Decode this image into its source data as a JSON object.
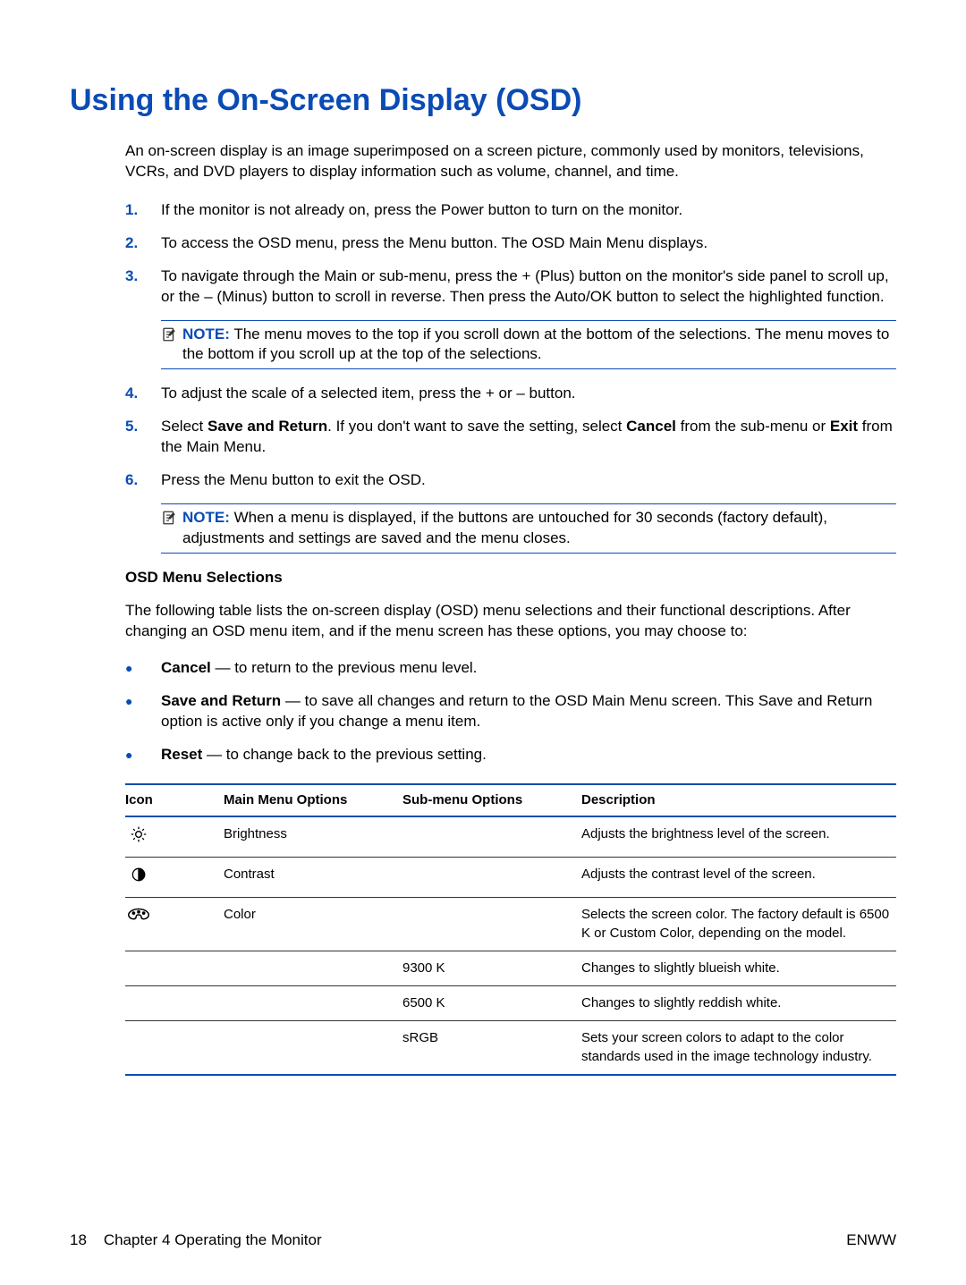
{
  "heading": "Using the On-Screen Display (OSD)",
  "intro": "An on-screen display is an image superimposed on a screen picture, commonly used by monitors, televisions, VCRs, and DVD players to display information such as volume, channel, and time.",
  "steps": {
    "s1": "If the monitor is not already on, press the Power button to turn on the monitor.",
    "s2": "To access the OSD menu, press the Menu button. The OSD Main Menu displays.",
    "s3": "To navigate through the Main or sub-menu, press the + (Plus) button on the monitor's side panel to scroll up, or the – (Minus) button to scroll in reverse. Then press the Auto/OK button to select the highlighted function.",
    "s4": "To adjust the scale of a selected item, press the + or – button.",
    "s5_pre": "Select ",
    "s5_save": "Save and Return",
    "s5_mid": ". If you don't want to save the setting, select ",
    "s5_cancel": "Cancel",
    "s5_mid2": " from the sub-menu or ",
    "s5_exit": "Exit",
    "s5_end": " from the Main Menu.",
    "s6": "Press the Menu button to exit the OSD."
  },
  "notes": {
    "label": "NOTE:",
    "n1": "The menu moves to the top if you scroll down at the bottom of the selections. The menu moves to the bottom if you scroll up at the top of the selections.",
    "n2": "When a menu is displayed, if the buttons are untouched for 30 seconds (factory default), adjustments and settings are saved and the menu closes."
  },
  "subhead": "OSD Menu Selections",
  "para2": "The following table lists the on-screen display (OSD) menu selections and their functional descriptions. After changing an OSD menu item, and if the menu screen has these options, you may choose to:",
  "bullets": {
    "b1_bold": "Cancel",
    "b1_rest": " — to return to the previous menu level.",
    "b2_bold": "Save and Return",
    "b2_rest": " — to save all changes and return to the OSD Main Menu screen. This Save and Return option is active only if you change a menu item.",
    "b3_bold": "Reset",
    "b3_rest": " — to change back to the previous setting."
  },
  "table": {
    "h_icon": "Icon",
    "h_main": "Main Menu Options",
    "h_sub": "Sub-menu Options",
    "h_desc": "Description",
    "rows": [
      {
        "icon": "brightness",
        "main": "Brightness",
        "sub": "",
        "desc": "Adjusts the brightness level of the screen."
      },
      {
        "icon": "contrast",
        "main": "Contrast",
        "sub": "",
        "desc": "Adjusts the contrast level of the screen."
      },
      {
        "icon": "color",
        "main": "Color",
        "sub": "",
        "desc": "Selects the screen color. The factory default is 6500 K or Custom Color, depending on the model."
      },
      {
        "icon": "",
        "main": "",
        "sub": "9300 K",
        "desc": "Changes to slightly blueish white."
      },
      {
        "icon": "",
        "main": "",
        "sub": "6500 K",
        "desc": "Changes to slightly reddish white."
      },
      {
        "icon": "",
        "main": "",
        "sub": "sRGB",
        "desc": "Sets your screen colors to adapt to the color standards used in the image technology industry."
      }
    ]
  },
  "footer": {
    "page_num": "18",
    "chapter": "Chapter 4   Operating the Monitor",
    "right": "ENWW"
  },
  "nums": {
    "n1": "1.",
    "n2": "2.",
    "n3": "3.",
    "n4": "4.",
    "n5": "5.",
    "n6": "6."
  },
  "bullet_char": "●"
}
